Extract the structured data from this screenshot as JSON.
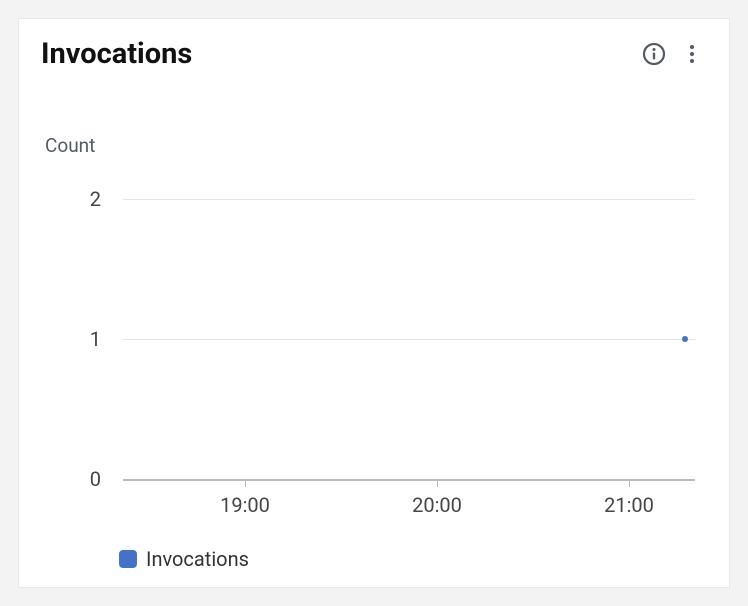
{
  "header": {
    "title": "Invocations"
  },
  "chart_data": {
    "type": "line",
    "ylabel": "Count",
    "xlabel": "",
    "y_ticks": [
      0,
      1,
      2
    ],
    "x_ticks": [
      "19:00",
      "20:00",
      "21:00"
    ],
    "ylim": [
      0,
      2
    ],
    "series": [
      {
        "name": "Invocations",
        "color": "#4472c4",
        "points": [
          {
            "x": "21:00",
            "y": 1
          }
        ]
      }
    ]
  },
  "legend": {
    "label": "Invocations"
  }
}
